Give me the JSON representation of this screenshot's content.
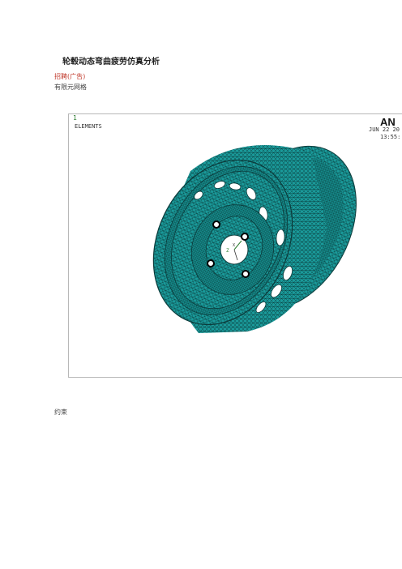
{
  "document": {
    "title": "轮毂动态弯曲疲劳仿真分析",
    "ad_link": "招聘(广告)",
    "section_mesh": "有限元网格",
    "section_constraint": "约束"
  },
  "figure": {
    "window_number": "1",
    "plot_label": "ELEMENTS",
    "logo_text": "AN",
    "date_text": "JUN 22 20",
    "time_text": "13:55:",
    "axis_z": "Z",
    "axis_x": "X",
    "mesh_color": "#1a9a9a",
    "mesh_line_color": "#0b3b3b"
  }
}
